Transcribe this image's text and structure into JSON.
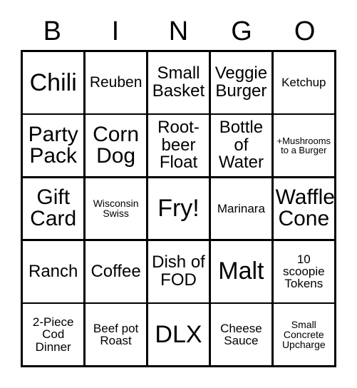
{
  "card": {
    "type": "bingo-card",
    "header_letters": [
      "B",
      "I",
      "N",
      "G",
      "O"
    ],
    "grid_size": "5x5",
    "colors": {
      "background": "#ffffff",
      "text": "#000000",
      "border": "#000000"
    },
    "rows": [
      [
        {
          "label": "Chili",
          "size": "fs-xl"
        },
        {
          "label": "Reuben",
          "size": "fs-sm"
        },
        {
          "label": "Small Basket",
          "size": "fs-md"
        },
        {
          "label": "Veggie Burger",
          "size": "fs-md"
        },
        {
          "label": "Ketchup",
          "size": "fs-xs"
        }
      ],
      [
        {
          "label": "Party Pack",
          "size": "fs-lg"
        },
        {
          "label": "Corn Dog",
          "size": "fs-lg"
        },
        {
          "label": "Root-beer Float",
          "size": "fs-md"
        },
        {
          "label": "Bottle of Water",
          "size": "fs-md"
        },
        {
          "label": "+Mushrooms to a Burger",
          "size": "fs-tiny"
        }
      ],
      [
        {
          "label": "Gift Card",
          "size": "fs-lg"
        },
        {
          "label": "Wisconsin Swiss",
          "size": "fs-xxs"
        },
        {
          "label": "Fry!",
          "size": "fs-xl"
        },
        {
          "label": "Marinara",
          "size": "fs-xs"
        },
        {
          "label": "Waffle Cone",
          "size": "fs-lg"
        }
      ],
      [
        {
          "label": "Ranch",
          "size": "fs-md"
        },
        {
          "label": "Coffee",
          "size": "fs-md"
        },
        {
          "label": "Dish of FOD",
          "size": "fs-md"
        },
        {
          "label": "Malt",
          "size": "fs-xl"
        },
        {
          "label": "10 scoopie Tokens",
          "size": "fs-xs"
        }
      ],
      [
        {
          "label": "2-Piece Cod Dinner",
          "size": "fs-xs"
        },
        {
          "label": "Beef pot Roast",
          "size": "fs-xs"
        },
        {
          "label": "DLX",
          "size": "fs-xl"
        },
        {
          "label": "Cheese Sauce",
          "size": "fs-xs"
        },
        {
          "label": "Small Concrete Upcharge",
          "size": "fs-xxs"
        }
      ]
    ]
  }
}
